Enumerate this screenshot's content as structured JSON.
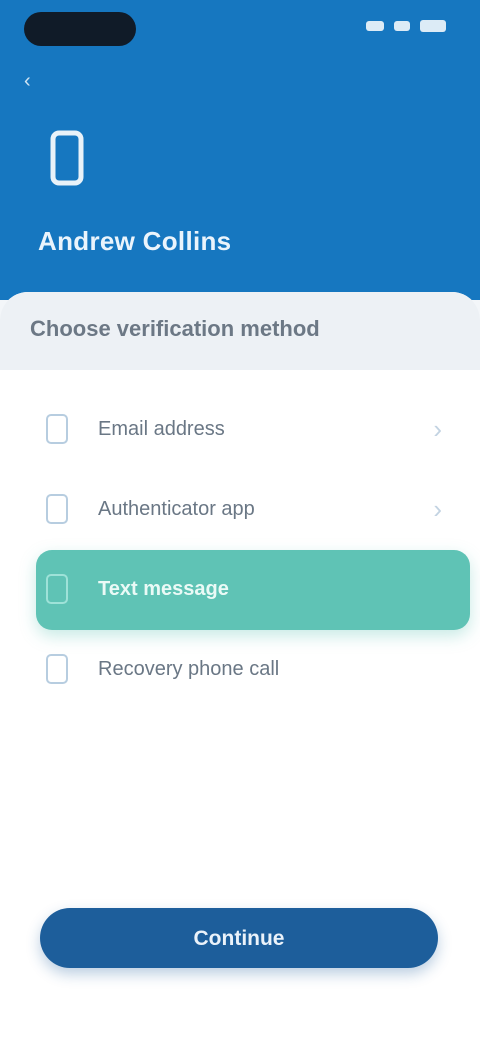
{
  "header": {
    "back_glyph": "‹",
    "user_name": "Andrew Collins"
  },
  "card": {
    "title": "Choose verification method"
  },
  "options": [
    {
      "label": "Email address",
      "icon": "mail-icon",
      "chevron": "›",
      "selected": false
    },
    {
      "label": "Authenticator app",
      "icon": "app-icon",
      "chevron": "›",
      "selected": false
    },
    {
      "label": "Text message",
      "icon": "sms-icon",
      "chevron": "›",
      "selected": true
    },
    {
      "label": "Recovery phone call",
      "icon": "phone-icon",
      "chevron": "›",
      "selected": false
    }
  ],
  "footer": {
    "continue_label": "Continue"
  },
  "colors": {
    "header_bg": "#1677c0",
    "selected_bg": "#5fc3b5",
    "button_bg": "#1d5e9b"
  }
}
